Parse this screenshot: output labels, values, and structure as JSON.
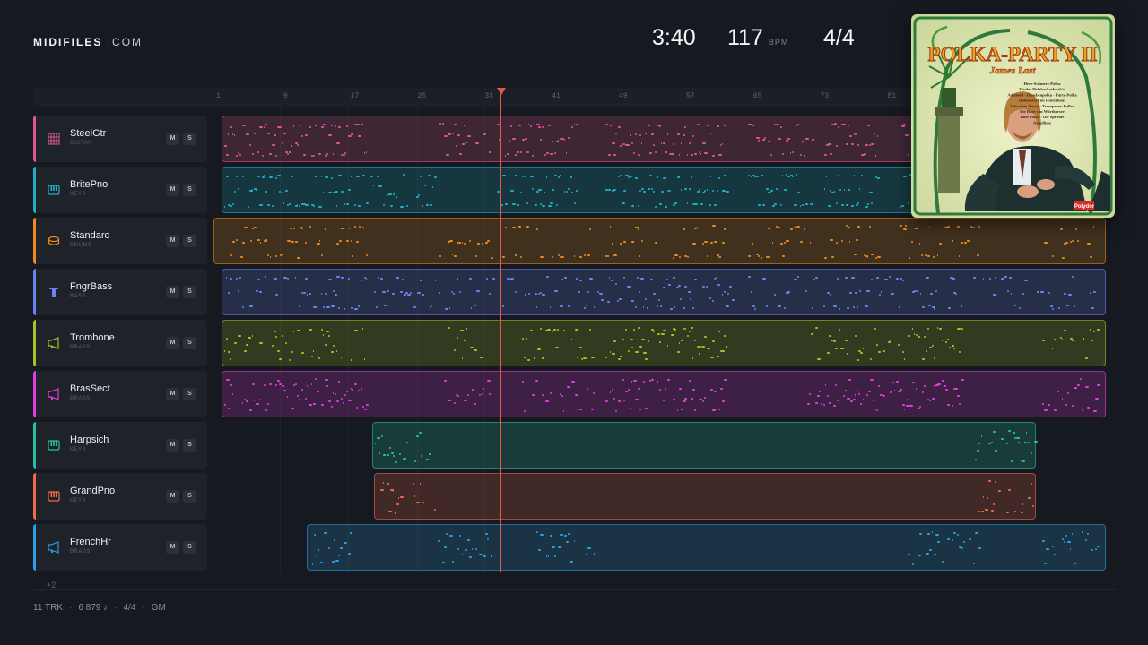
{
  "brand": {
    "name": "MIDIFILES",
    "suffix": ".COM"
  },
  "transport": {
    "time": "3:40",
    "bpm": "117",
    "bpm_unit": "BPM",
    "time_signature": "4/4"
  },
  "album": {
    "title": "POLKA-PARTY II",
    "artist": "James Last",
    "tracklist": [
      "Herz-Schmerz-Polka",
      "Tiroler Holzhackerbuab'n",
      "Adelheid · Danebenpolka · Party-Polka",
      "Hofkonzert im Hinterhaus",
      "Schwarze Amsel · Trompeten-Jodler",
      "Die Rose von Wörthersee",
      "Blue Polka · Die Sprühle",
      "Annelliese"
    ],
    "label": "Polydor"
  },
  "ruler": {
    "ticks": [
      "1",
      "9",
      "17",
      "25",
      "33",
      "41",
      "49",
      "57",
      "65",
      "73",
      "81"
    ]
  },
  "playhead_bar": 33,
  "tracks": [
    {
      "name": "SteelGtr",
      "category": "GUITAR",
      "icon": "guitar-icon",
      "color": "#e0588f",
      "mute": "M",
      "solo": "S"
    },
    {
      "name": "BritePno",
      "category": "KEYS",
      "icon": "piano-icon",
      "color": "#1fb0c8",
      "mute": "M",
      "solo": "S"
    },
    {
      "name": "Standard",
      "category": "DRUMS",
      "icon": "drum-icon",
      "color": "#ec8a1e",
      "mute": "M",
      "solo": "S"
    },
    {
      "name": "FngrBass",
      "category": "BASS",
      "icon": "bass-icon",
      "color": "#6f82f2",
      "mute": "M",
      "solo": "S"
    },
    {
      "name": "Trombone",
      "category": "BRASS",
      "icon": "horn-icon",
      "color": "#a7c225",
      "mute": "M",
      "solo": "S"
    },
    {
      "name": "BrasSect",
      "category": "BRASS",
      "icon": "horn-icon",
      "color": "#e03ee0",
      "mute": "M",
      "solo": "S"
    },
    {
      "name": "Harpsich",
      "category": "KEYS",
      "icon": "piano-icon",
      "color": "#26c1a4",
      "mute": "M",
      "solo": "S"
    },
    {
      "name": "GrandPno",
      "category": "KEYS",
      "icon": "piano-icon",
      "color": "#f06a4e",
      "mute": "M",
      "solo": "S"
    },
    {
      "name": "FrenchHr",
      "category": "BRASS",
      "icon": "horn-icon",
      "color": "#2b9fe6",
      "mute": "M",
      "solo": "S"
    }
  ],
  "hidden_tracks": "+2",
  "footer": {
    "tracks": "11 TRK",
    "notes": "6 879 ♪",
    "time_signature": "4/4",
    "standard": "GM"
  }
}
